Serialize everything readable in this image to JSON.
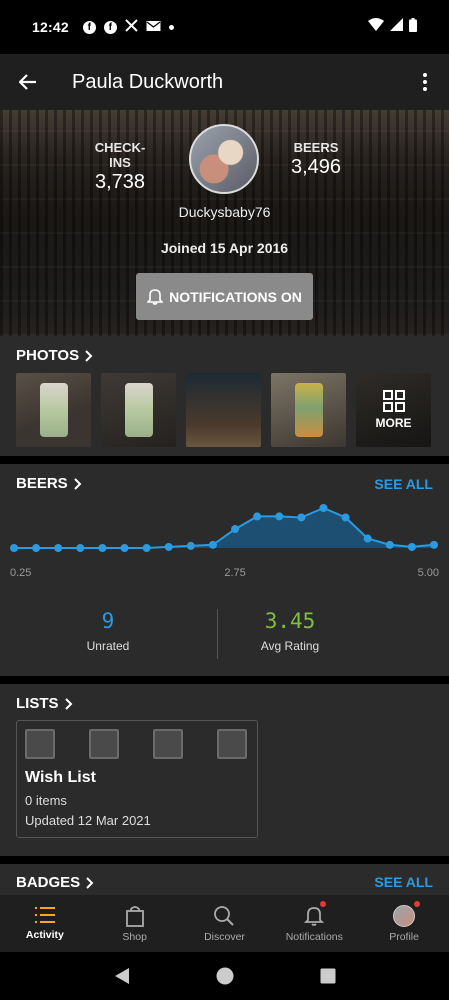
{
  "status_bar": {
    "time": "12:42"
  },
  "app_bar": {
    "title": "Paula Duckworth"
  },
  "profile": {
    "checkins_label": "CHECK-INS",
    "checkins_value": "3,738",
    "beers_label": "BEERS",
    "beers_value": "3,496",
    "username": "Duckysbaby76",
    "joined": "Joined 15 Apr 2016",
    "notifications_button": "NOTIFICATIONS ON"
  },
  "photos": {
    "title": "PHOTOS",
    "more_label": "MORE"
  },
  "beers": {
    "title": "BEERS",
    "see_all": "SEE ALL",
    "unrated_value": "9",
    "unrated_label": "Unrated",
    "avg_value": "3.45",
    "avg_label": "Avg Rating"
  },
  "chart_data": {
    "type": "area",
    "x": [
      0.25,
      0.5,
      0.75,
      1.0,
      1.25,
      1.5,
      1.75,
      2.0,
      2.25,
      2.5,
      2.75,
      3.0,
      3.25,
      3.5,
      3.75,
      4.0,
      4.25,
      4.5,
      4.75,
      5.0
    ],
    "values": [
      0,
      0,
      0,
      0,
      0,
      0,
      0,
      1,
      2,
      3,
      18,
      30,
      30,
      29,
      38,
      29,
      9,
      3,
      1,
      3
    ],
    "tick_labels": [
      "0.25",
      "2.75",
      "5.00"
    ],
    "xlim": [
      0.25,
      5.0
    ],
    "color": "#2a9be0"
  },
  "lists": {
    "title": "LISTS",
    "card": {
      "name": "Wish List",
      "count": "0 items",
      "updated": "Updated 12 Mar 2021"
    }
  },
  "badges": {
    "title": "BADGES",
    "see_all": "SEE ALL"
  },
  "bottom_nav": {
    "items": [
      {
        "label": "Activity",
        "icon": "activity-list-icon",
        "active": true
      },
      {
        "label": "Shop",
        "icon": "shopping-bag-icon"
      },
      {
        "label": "Discover",
        "icon": "search-icon"
      },
      {
        "label": "Notifications",
        "icon": "bell-icon",
        "badge": true
      },
      {
        "label": "Profile",
        "icon": "avatar",
        "badge": true
      }
    ]
  },
  "colors": {
    "accent": "#2a9be0",
    "rating_green": "#7bc043",
    "badge_red": "#e53935"
  }
}
